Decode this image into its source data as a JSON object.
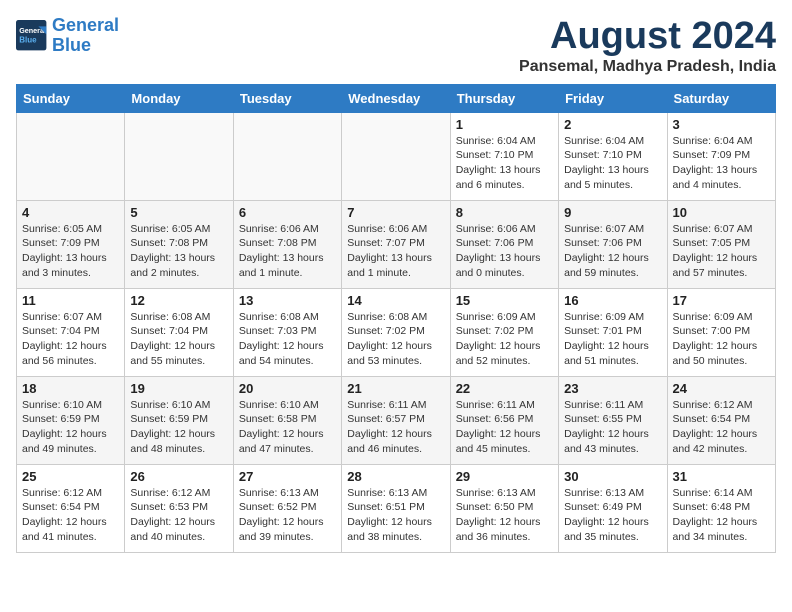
{
  "header": {
    "logo_line1": "General",
    "logo_line2": "Blue",
    "month": "August 2024",
    "location": "Pansemal, Madhya Pradesh, India"
  },
  "weekdays": [
    "Sunday",
    "Monday",
    "Tuesday",
    "Wednesday",
    "Thursday",
    "Friday",
    "Saturday"
  ],
  "weeks": [
    [
      {
        "day": "",
        "info": ""
      },
      {
        "day": "",
        "info": ""
      },
      {
        "day": "",
        "info": ""
      },
      {
        "day": "",
        "info": ""
      },
      {
        "day": "1",
        "info": "Sunrise: 6:04 AM\nSunset: 7:10 PM\nDaylight: 13 hours\nand 6 minutes."
      },
      {
        "day": "2",
        "info": "Sunrise: 6:04 AM\nSunset: 7:10 PM\nDaylight: 13 hours\nand 5 minutes."
      },
      {
        "day": "3",
        "info": "Sunrise: 6:04 AM\nSunset: 7:09 PM\nDaylight: 13 hours\nand 4 minutes."
      }
    ],
    [
      {
        "day": "4",
        "info": "Sunrise: 6:05 AM\nSunset: 7:09 PM\nDaylight: 13 hours\nand 3 minutes."
      },
      {
        "day": "5",
        "info": "Sunrise: 6:05 AM\nSunset: 7:08 PM\nDaylight: 13 hours\nand 2 minutes."
      },
      {
        "day": "6",
        "info": "Sunrise: 6:06 AM\nSunset: 7:08 PM\nDaylight: 13 hours\nand 1 minute."
      },
      {
        "day": "7",
        "info": "Sunrise: 6:06 AM\nSunset: 7:07 PM\nDaylight: 13 hours\nand 1 minute."
      },
      {
        "day": "8",
        "info": "Sunrise: 6:06 AM\nSunset: 7:06 PM\nDaylight: 13 hours\nand 0 minutes."
      },
      {
        "day": "9",
        "info": "Sunrise: 6:07 AM\nSunset: 7:06 PM\nDaylight: 12 hours\nand 59 minutes."
      },
      {
        "day": "10",
        "info": "Sunrise: 6:07 AM\nSunset: 7:05 PM\nDaylight: 12 hours\nand 57 minutes."
      }
    ],
    [
      {
        "day": "11",
        "info": "Sunrise: 6:07 AM\nSunset: 7:04 PM\nDaylight: 12 hours\nand 56 minutes."
      },
      {
        "day": "12",
        "info": "Sunrise: 6:08 AM\nSunset: 7:04 PM\nDaylight: 12 hours\nand 55 minutes."
      },
      {
        "day": "13",
        "info": "Sunrise: 6:08 AM\nSunset: 7:03 PM\nDaylight: 12 hours\nand 54 minutes."
      },
      {
        "day": "14",
        "info": "Sunrise: 6:08 AM\nSunset: 7:02 PM\nDaylight: 12 hours\nand 53 minutes."
      },
      {
        "day": "15",
        "info": "Sunrise: 6:09 AM\nSunset: 7:02 PM\nDaylight: 12 hours\nand 52 minutes."
      },
      {
        "day": "16",
        "info": "Sunrise: 6:09 AM\nSunset: 7:01 PM\nDaylight: 12 hours\nand 51 minutes."
      },
      {
        "day": "17",
        "info": "Sunrise: 6:09 AM\nSunset: 7:00 PM\nDaylight: 12 hours\nand 50 minutes."
      }
    ],
    [
      {
        "day": "18",
        "info": "Sunrise: 6:10 AM\nSunset: 6:59 PM\nDaylight: 12 hours\nand 49 minutes."
      },
      {
        "day": "19",
        "info": "Sunrise: 6:10 AM\nSunset: 6:59 PM\nDaylight: 12 hours\nand 48 minutes."
      },
      {
        "day": "20",
        "info": "Sunrise: 6:10 AM\nSunset: 6:58 PM\nDaylight: 12 hours\nand 47 minutes."
      },
      {
        "day": "21",
        "info": "Sunrise: 6:11 AM\nSunset: 6:57 PM\nDaylight: 12 hours\nand 46 minutes."
      },
      {
        "day": "22",
        "info": "Sunrise: 6:11 AM\nSunset: 6:56 PM\nDaylight: 12 hours\nand 45 minutes."
      },
      {
        "day": "23",
        "info": "Sunrise: 6:11 AM\nSunset: 6:55 PM\nDaylight: 12 hours\nand 43 minutes."
      },
      {
        "day": "24",
        "info": "Sunrise: 6:12 AM\nSunset: 6:54 PM\nDaylight: 12 hours\nand 42 minutes."
      }
    ],
    [
      {
        "day": "25",
        "info": "Sunrise: 6:12 AM\nSunset: 6:54 PM\nDaylight: 12 hours\nand 41 minutes."
      },
      {
        "day": "26",
        "info": "Sunrise: 6:12 AM\nSunset: 6:53 PM\nDaylight: 12 hours\nand 40 minutes."
      },
      {
        "day": "27",
        "info": "Sunrise: 6:13 AM\nSunset: 6:52 PM\nDaylight: 12 hours\nand 39 minutes."
      },
      {
        "day": "28",
        "info": "Sunrise: 6:13 AM\nSunset: 6:51 PM\nDaylight: 12 hours\nand 38 minutes."
      },
      {
        "day": "29",
        "info": "Sunrise: 6:13 AM\nSunset: 6:50 PM\nDaylight: 12 hours\nand 36 minutes."
      },
      {
        "day": "30",
        "info": "Sunrise: 6:13 AM\nSunset: 6:49 PM\nDaylight: 12 hours\nand 35 minutes."
      },
      {
        "day": "31",
        "info": "Sunrise: 6:14 AM\nSunset: 6:48 PM\nDaylight: 12 hours\nand 34 minutes."
      }
    ]
  ]
}
